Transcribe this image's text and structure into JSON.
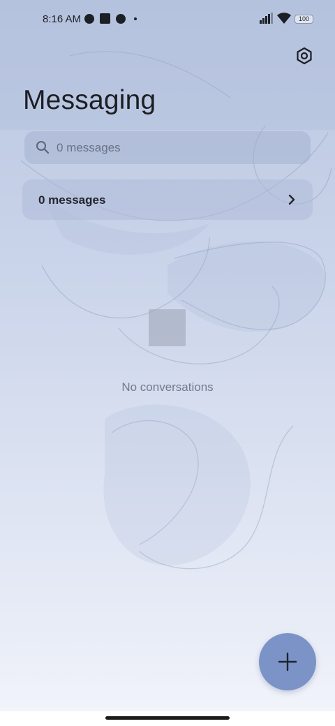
{
  "status_bar": {
    "time": "8:16 AM",
    "icons": [
      "notification-circle-icon",
      "notification-square-icon",
      "notification-circle-icon",
      "more-dot-icon",
      "signal-icon",
      "wifi-icon"
    ],
    "battery": "100"
  },
  "header": {
    "title": "Messaging",
    "settings_icon": "settings-icon"
  },
  "search": {
    "placeholder": "0 messages",
    "icon": "search-icon"
  },
  "summary": {
    "label": "0 messages",
    "icon": "chevron-right-icon"
  },
  "empty_state": {
    "icon": "message-icon",
    "text": "No conversations"
  },
  "fab": {
    "icon": "plus-icon",
    "color": "#7b93c6"
  },
  "colors": {
    "accent": "#7b93c6",
    "text_primary": "#1c1e24",
    "text_muted": "#727b8d"
  }
}
